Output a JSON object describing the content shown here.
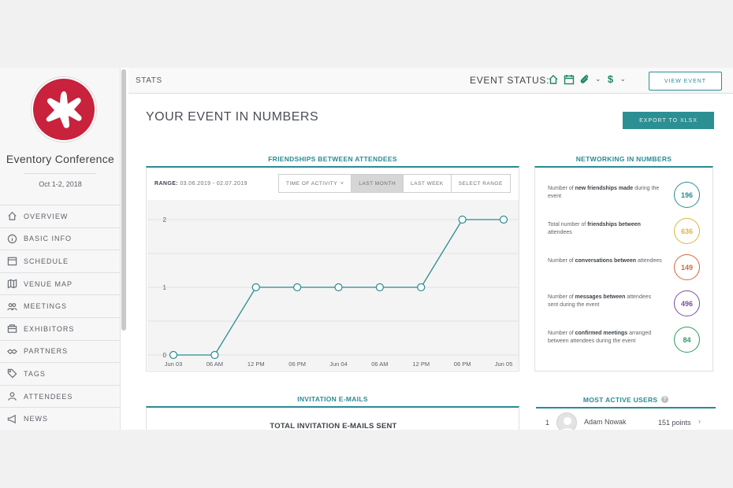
{
  "sidebar": {
    "event_name": "Eventory Conference",
    "event_date": "Oct 1-2, 2018",
    "items": [
      {
        "label": "OVERVIEW",
        "icon": "home-icon"
      },
      {
        "label": "BASIC INFO",
        "icon": "info-icon"
      },
      {
        "label": "SCHEDULE",
        "icon": "schedule-icon"
      },
      {
        "label": "VENUE MAP",
        "icon": "map-icon"
      },
      {
        "label": "MEETINGS",
        "icon": "meetings-icon"
      },
      {
        "label": "EXHIBITORS",
        "icon": "exhibitors-icon"
      },
      {
        "label": "PARTNERS",
        "icon": "partners-icon"
      },
      {
        "label": "TAGS",
        "icon": "tag-icon"
      },
      {
        "label": "ATTENDEES",
        "icon": "attendees-icon"
      },
      {
        "label": "NEWS",
        "icon": "news-icon"
      }
    ]
  },
  "topbar": {
    "stats": "STATS",
    "event_status": "EVENT STATUS:",
    "view_event": "VIEW EVENT",
    "status_color": "#1f8a5f"
  },
  "main": {
    "title": "YOUR EVENT IN NUMBERS",
    "export": "EXPORT TO XLSX"
  },
  "friendships": {
    "title": "FRIENDSHIPS BETWEEN ATTENDEES",
    "range_label": "RANGE:",
    "range_value": "03.06.2019 - 02.07.2019",
    "filters": [
      "TIME OF ACTIVITY",
      "LAST MONTH",
      "LAST WEEK",
      "SELECT RANGE"
    ],
    "active_filter": "LAST MONTH"
  },
  "chart_data": {
    "type": "line",
    "categories": [
      "Jun 03",
      "06 AM",
      "12 PM",
      "06 PM",
      "Jun 04",
      "06 AM",
      "12 PM",
      "06 PM",
      "Jun 05"
    ],
    "values": [
      0,
      0,
      1,
      1,
      1,
      1,
      1,
      2,
      2
    ],
    "yticks": [
      "0",
      "1",
      "2"
    ],
    "ylim": [
      0,
      2
    ],
    "grid": true,
    "color": "#2a8b91"
  },
  "networking": {
    "title": "NETWORKING IN NUMBERS",
    "items": [
      {
        "pre": "Number of ",
        "bold": "new friendships made",
        "post": " during the event",
        "value": "196",
        "color": "#2a8b91"
      },
      {
        "pre": "Total number of ",
        "bold": "friendships between",
        "post": " attendees",
        "value": "636",
        "color": "#e0b33c"
      },
      {
        "pre": "Number of ",
        "bold": "conversations between",
        "post": " attendees",
        "value": "149",
        "color": "#d9643a"
      },
      {
        "pre": "Number of ",
        "bold": "messages between",
        "post": " attendees sent during the event",
        "value": "496",
        "color": "#7b4f9c"
      },
      {
        "pre": "Number of ",
        "bold": "confirmed meetings",
        "post": " arranged between attendees during the event",
        "value": "84",
        "color": "#2f9a5d"
      }
    ]
  },
  "invitations": {
    "title": "INVITATION E-MAILS",
    "total_label": "TOTAL INVITATION E-MAILS SENT"
  },
  "active_users": {
    "title": "MOST ACTIVE USERS",
    "rows": [
      {
        "rank": "1",
        "name": "Adam Nowak",
        "points": "151 points"
      }
    ]
  }
}
